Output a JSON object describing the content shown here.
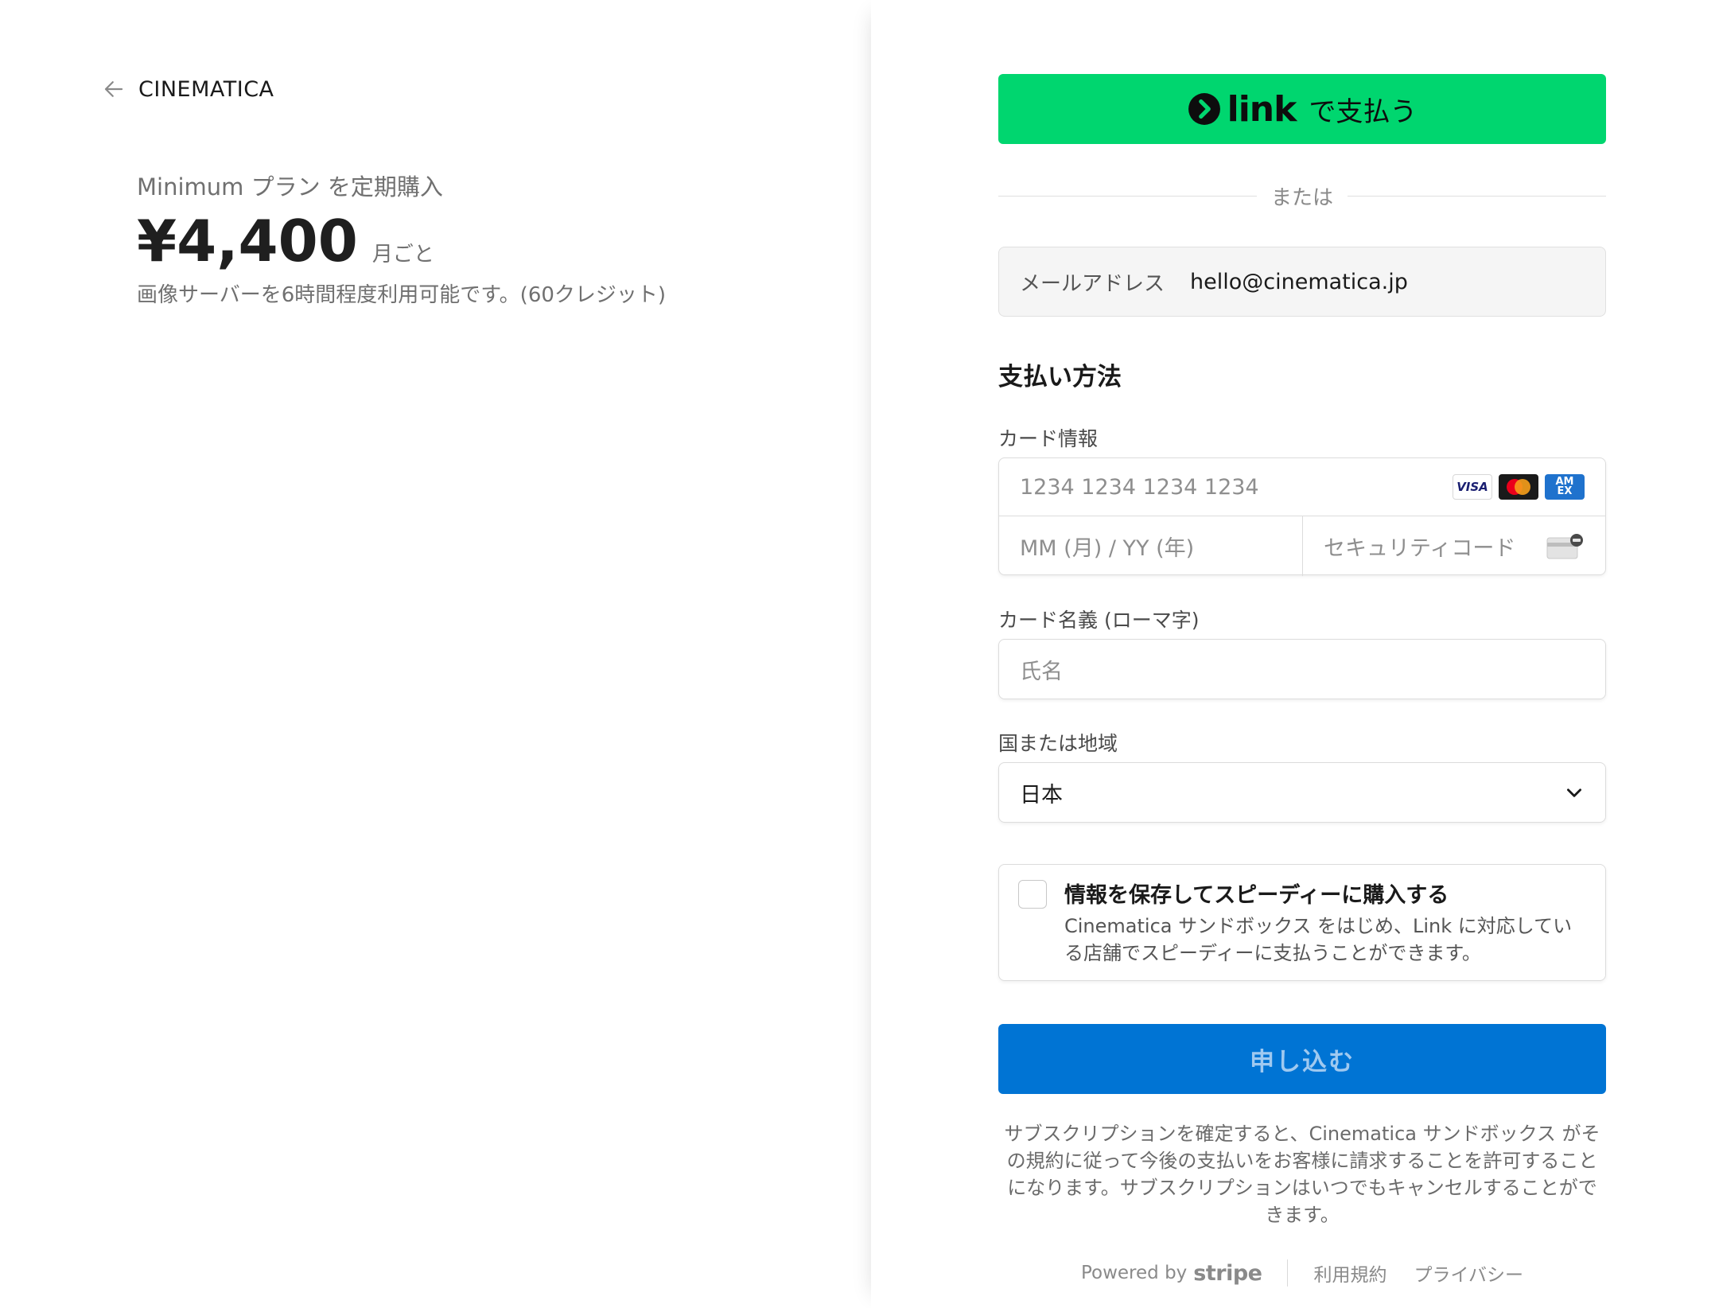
{
  "merchant": {
    "name": "CINEMATICA"
  },
  "plan": {
    "title": "Minimum プラン を定期購入",
    "price": "¥4,400",
    "period": "月ごと",
    "description": "画像サーバーを6時間程度利用可能です。(60クレジット)"
  },
  "link_button": {
    "word": "link",
    "suffix": "で支払う",
    "color": "#00d66f"
  },
  "divider": {
    "text": "または"
  },
  "email": {
    "label": "メールアドレス",
    "value": "hello@cinematica.jp"
  },
  "payment": {
    "section_title": "支払い方法",
    "card_label": "カード情報",
    "card_number_placeholder": "1234 1234 1234 1234",
    "expiry_placeholder": "MM (月) / YY (年)",
    "cvc_placeholder": "セキュリティコード",
    "card_brands": [
      "visa-icon",
      "mastercard-icon",
      "amex-icon"
    ],
    "name_label": "カード名義 (ローマ字)",
    "name_placeholder": "氏名",
    "country_label": "国または地域",
    "country_value": "日本"
  },
  "save_info": {
    "title": "情報を保存してスピーディーに購入する",
    "description": "Cinematica サンドボックス をはじめ、Link に対応している店舗でスピーディーに支払うことができます。"
  },
  "submit": {
    "label": "申し込む",
    "color": "#0074d4"
  },
  "terms": "サブスクリプションを確定すると、Cinematica サンドボックス がその規約に従って今後の支払いをお客様に請求することを許可することになります。サブスクリプションはいつでもキャンセルすることができます。",
  "footer": {
    "powered_by": "Powered by",
    "stripe": "stripe",
    "links": [
      "利用規約",
      "プライバシー"
    ]
  }
}
